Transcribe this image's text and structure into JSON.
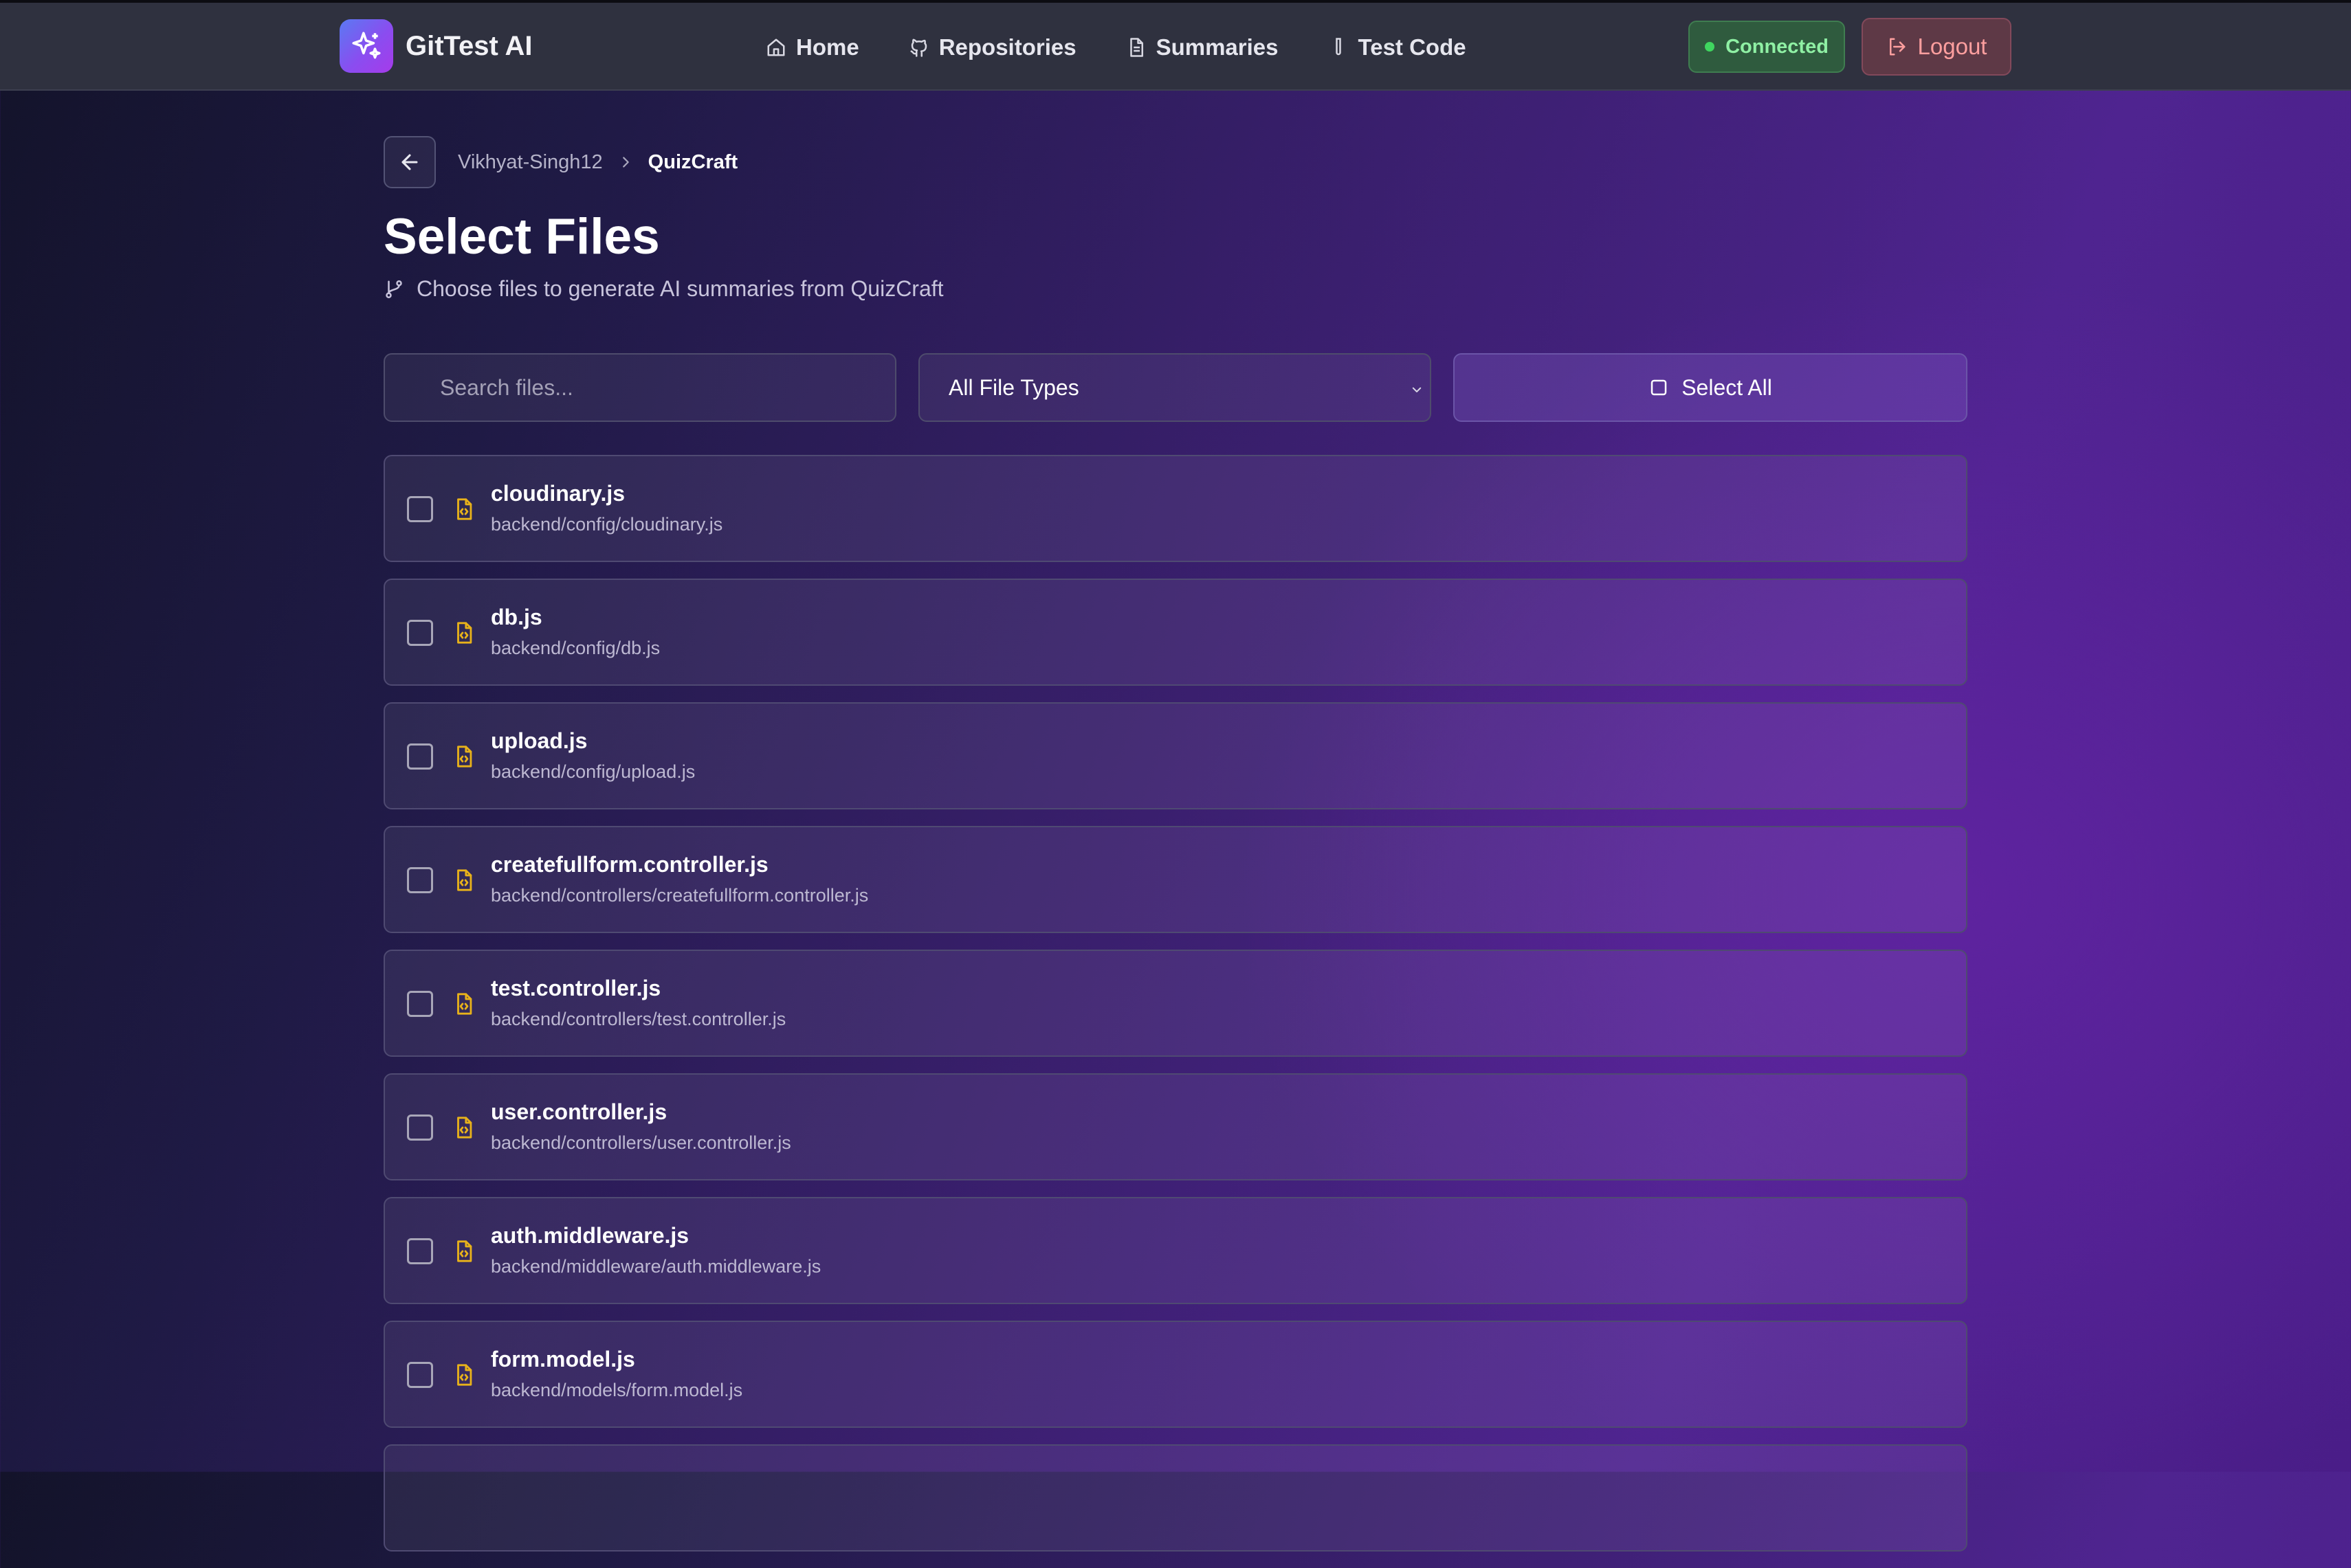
{
  "app": {
    "name": "GitTest AI",
    "colors": {
      "accent": "#8a4df0",
      "connected": "#3fd65f",
      "logout": "#ff9f9f",
      "file_icon": "#e8b21a"
    }
  },
  "nav": [
    {
      "label": "Home",
      "icon": "home-icon"
    },
    {
      "label": "Repositories",
      "icon": "github-icon"
    },
    {
      "label": "Summaries",
      "icon": "document-icon"
    },
    {
      "label": "Test Code",
      "icon": "test-tube-icon"
    }
  ],
  "status": {
    "label": "Connected"
  },
  "logout": {
    "label": "Logout"
  },
  "breadcrumb": {
    "owner": "Vikhyat-Singh12",
    "repo": "QuizCraft"
  },
  "page": {
    "title": "Select Files",
    "subtitle": "Choose files to generate AI summaries from QuizCraft"
  },
  "controls": {
    "search_placeholder": "Search files...",
    "type_filter": "All File Types",
    "select_all": "Select All"
  },
  "files": [
    {
      "name": "cloudinary.js",
      "path": "backend/config/cloudinary.js",
      "checked": false
    },
    {
      "name": "db.js",
      "path": "backend/config/db.js",
      "checked": false
    },
    {
      "name": "upload.js",
      "path": "backend/config/upload.js",
      "checked": false
    },
    {
      "name": "createfullform.controller.js",
      "path": "backend/controllers/createfullform.controller.js",
      "checked": false
    },
    {
      "name": "test.controller.js",
      "path": "backend/controllers/test.controller.js",
      "checked": false
    },
    {
      "name": "user.controller.js",
      "path": "backend/controllers/user.controller.js",
      "checked": false
    },
    {
      "name": "auth.middleware.js",
      "path": "backend/middleware/auth.middleware.js",
      "checked": false
    },
    {
      "name": "form.model.js",
      "path": "backend/models/form.model.js",
      "checked": false
    }
  ]
}
